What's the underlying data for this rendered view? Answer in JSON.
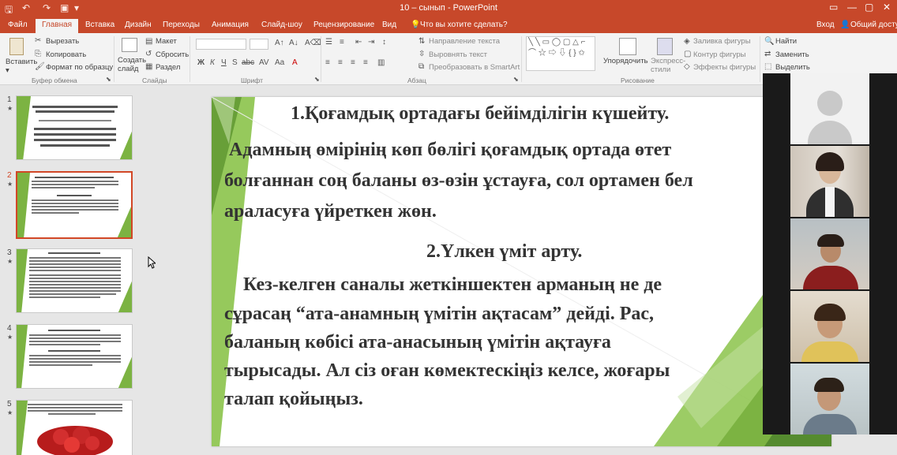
{
  "app": {
    "title": "10 – сынып - PowerPoint"
  },
  "window": {
    "help_icon": "?",
    "minimize": "—",
    "restore": "▢",
    "close": "✕"
  },
  "tabs": [
    {
      "label": "Файл"
    },
    {
      "label": "Главная"
    },
    {
      "label": "Вставка"
    },
    {
      "label": "Дизайн"
    },
    {
      "label": "Переходы"
    },
    {
      "label": "Анимация"
    },
    {
      "label": "Слайд-шоу"
    },
    {
      "label": "Рецензирование"
    },
    {
      "label": "Вид"
    },
    {
      "label": "Что вы хотите сделать?"
    }
  ],
  "account": {
    "signin": "Вход",
    "share": "Общий доступ"
  },
  "ribbon": {
    "paste": "Вставить",
    "cut": "Вырезать",
    "copy": "Копировать",
    "format_painter": "Формат по образцу",
    "clipboard_group": "Буфер обмена",
    "new_slide": "Создать слайд",
    "layout": "Макет",
    "reset": "Сбросить",
    "section": "Раздел",
    "slides_group": "Слайды",
    "font_group": "Шрифт",
    "text_direction": "Направление текста",
    "align_text": "Выровнять текст",
    "smartart": "Преобразовать в SmartArt",
    "paragraph_group": "Абзац",
    "arrange": "Упорядочить",
    "quick_styles": "Экспресс-стили",
    "shape_fill": "Заливка фигуры",
    "shape_outline": "Контур фигуры",
    "shape_effects": "Эффекты фигуры",
    "drawing_group": "Рисование",
    "find": "Найти",
    "replace": "Заменить",
    "select": "Выделить"
  },
  "thumbnails": [
    {
      "num": "1"
    },
    {
      "num": "2"
    },
    {
      "num": "3"
    },
    {
      "num": "4"
    },
    {
      "num": "5"
    }
  ],
  "slide": {
    "heading1": "1.Қоғамдық ортадағы бейімділігін күшейту.",
    "para1_l1": "Адамның өмірінің көп бөлігі қоғамдық ортада өтет",
    "para1_l2": "болғаннан соң баланы өз-өзін ұстауға, сол ортамен бел",
    "para1_l3": "араласуға үйреткен жөн.",
    "heading2": "2.Үлкен үміт арту.",
    "para2_l1": "Кез-келген саналы жеткіншектен арманың не де",
    "para2_l2": "сұрасаң “ата-анамның үмітін ақтасам” дейді. Рас,",
    "para2_l3": "баланың көбісі ата-анасының үмітін ақтауға",
    "para2_l4": "тырысады. Ал сіз оған көмектескіңіз келсе, жоғары",
    "para2_l5": "талап қойыңыз."
  },
  "colors": {
    "accent": "#c7482a",
    "ribbon_bg": "#f3f3f3",
    "slide_green": "#7cb342",
    "slide_text": "#333333"
  }
}
